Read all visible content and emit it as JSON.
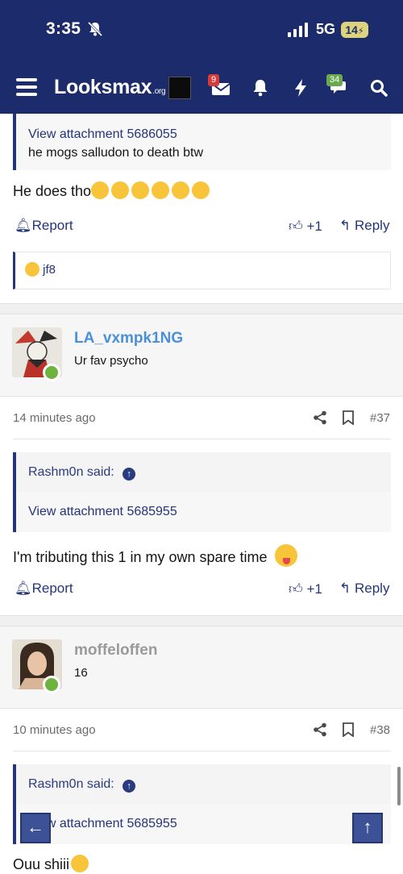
{
  "status_bar": {
    "time": "3:35",
    "network": "5G",
    "battery": "14"
  },
  "nav": {
    "logo": "Looksmax",
    "logo_suffix": ".org",
    "mail_badge": "9",
    "chat_badge": "34"
  },
  "post1": {
    "quote_text_1": "View attachment 5686055",
    "quote_text_2": "he mogs salludon to death btw",
    "body": "He does tho",
    "emoji_count": "6",
    "report": "Report",
    "likes": "+1",
    "reply": "Reply",
    "reaction_user": "jf8"
  },
  "post2": {
    "username": "LA_vxmpk1NG",
    "user_title": "Ur fav psycho",
    "time_ago": "14 minutes ago",
    "post_number": "#37",
    "quote_author": "Rashm0n said:",
    "quote_body": "View attachment 5685955",
    "body": "I'm tributing this 1 in my own spare time",
    "report": "Report",
    "likes": "+1",
    "reply": "Reply"
  },
  "post3": {
    "username": "moffeloffen",
    "user_title": "16",
    "time_ago": "10 minutes ago",
    "post_number": "#38",
    "quote_author": "Rashm0n said:",
    "quote_body": "View attachment 5685955",
    "body": "Ouu shiii"
  },
  "colors": {
    "header": "#1c2b6b",
    "accent": "#24357a",
    "username_blue": "#4a90d9",
    "username_gray": "#9a9a9a",
    "online": "#6eb33f"
  }
}
